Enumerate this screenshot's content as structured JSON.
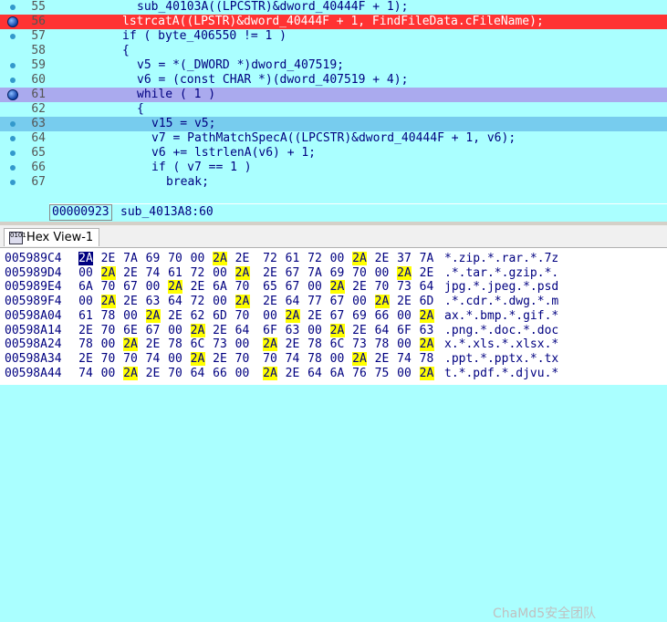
{
  "pseudocode": {
    "lines": [
      {
        "num": "55",
        "text": "sub_40103A((LPCSTR)&dword_40444F + 1);",
        "indent": 150,
        "marker": "dot",
        "style": ""
      },
      {
        "num": "56",
        "text": "lstrcatA((LPSTR)&dword_40444F + 1, FindFileData.cFileName);",
        "indent": 134,
        "marker": "bigdot",
        "style": "bp"
      },
      {
        "num": "57",
        "text": "if ( byte_406550 != 1 )",
        "indent": 134,
        "marker": "dot",
        "style": ""
      },
      {
        "num": "58",
        "text": "{",
        "indent": 134,
        "marker": "",
        "style": ""
      },
      {
        "num": "59",
        "text": "v5 = *(_DWORD *)dword_407519;",
        "indent": 150,
        "marker": "dot",
        "style": ""
      },
      {
        "num": "60",
        "text": "v6 = (const CHAR *)(dword_407519 + 4);",
        "indent": 150,
        "marker": "dot",
        "style": ""
      },
      {
        "num": "61",
        "text": "while ( 1 )",
        "indent": 150,
        "marker": "bigdot",
        "style": "cur"
      },
      {
        "num": "62",
        "text": "{",
        "indent": 150,
        "marker": "",
        "style": ""
      },
      {
        "num": "63",
        "text": "v15 = v5;",
        "indent": 166,
        "marker": "dot",
        "style": "sel"
      },
      {
        "num": "64",
        "text": "v7 = PathMatchSpecA((LPCSTR)&dword_40444F + 1, v6);",
        "indent": 166,
        "marker": "dot",
        "style": ""
      },
      {
        "num": "65",
        "text": "v6 += lstrlenA(v6) + 1;",
        "indent": 166,
        "marker": "dot",
        "style": ""
      },
      {
        "num": "66",
        "text": "if ( v7 == 1 )",
        "indent": 166,
        "marker": "dot",
        "style": ""
      },
      {
        "num": "67",
        "text": "break;",
        "indent": 182,
        "marker": "dot",
        "style": ""
      }
    ]
  },
  "status": {
    "offset": "00000923",
    "location": "sub_4013A8:60"
  },
  "hexview": {
    "tab_title": "Hex View-1",
    "tab_icon": "hex-view-icon",
    "rows": [
      {
        "addr": "005989C4",
        "bytes": [
          "2A",
          "2E",
          "7A",
          "69",
          "70",
          "00",
          "2A",
          "2E",
          "72",
          "61",
          "72",
          "00",
          "2A",
          "2E",
          "37",
          "7A"
        ],
        "ascii": "*.zip.*.rar.*.7z"
      },
      {
        "addr": "005989D4",
        "bytes": [
          "00",
          "2A",
          "2E",
          "74",
          "61",
          "72",
          "00",
          "2A",
          "2E",
          "67",
          "7A",
          "69",
          "70",
          "00",
          "2A",
          "2E"
        ],
        "ascii": ".*.tar.*.gzip.*."
      },
      {
        "addr": "005989E4",
        "bytes": [
          "6A",
          "70",
          "67",
          "00",
          "2A",
          "2E",
          "6A",
          "70",
          "65",
          "67",
          "00",
          "2A",
          "2E",
          "70",
          "73",
          "64"
        ],
        "ascii": "jpg.*.jpeg.*.psd"
      },
      {
        "addr": "005989F4",
        "bytes": [
          "00",
          "2A",
          "2E",
          "63",
          "64",
          "72",
          "00",
          "2A",
          "2E",
          "64",
          "77",
          "67",
          "00",
          "2A",
          "2E",
          "6D"
        ],
        "ascii": ".*.cdr.*.dwg.*.m"
      },
      {
        "addr": "00598A04",
        "bytes": [
          "61",
          "78",
          "00",
          "2A",
          "2E",
          "62",
          "6D",
          "70",
          "00",
          "2A",
          "2E",
          "67",
          "69",
          "66",
          "00",
          "2A"
        ],
        "ascii": "ax.*.bmp.*.gif.*"
      },
      {
        "addr": "00598A14",
        "bytes": [
          "2E",
          "70",
          "6E",
          "67",
          "00",
          "2A",
          "2E",
          "64",
          "6F",
          "63",
          "00",
          "2A",
          "2E",
          "64",
          "6F",
          "63"
        ],
        "ascii": ".png.*.doc.*.doc"
      },
      {
        "addr": "00598A24",
        "bytes": [
          "78",
          "00",
          "2A",
          "2E",
          "78",
          "6C",
          "73",
          "00",
          "2A",
          "2E",
          "78",
          "6C",
          "73",
          "78",
          "00",
          "2A"
        ],
        "ascii": "x.*.xls.*.xlsx.*"
      },
      {
        "addr": "00598A34",
        "bytes": [
          "2E",
          "70",
          "70",
          "74",
          "00",
          "2A",
          "2E",
          "70",
          "70",
          "74",
          "78",
          "00",
          "2A",
          "2E",
          "74",
          "78"
        ],
        "ascii": ".ppt.*.pptx.*.tx"
      },
      {
        "addr": "00598A44",
        "bytes": [
          "74",
          "00",
          "2A",
          "2E",
          "70",
          "64",
          "66",
          "00",
          "2A",
          "2E",
          "64",
          "6A",
          "76",
          "75",
          "00",
          "2A"
        ],
        "ascii": "t.*.pdf.*.djvu.*"
      }
    ]
  },
  "watermark": "ChaMd5安全团队"
}
